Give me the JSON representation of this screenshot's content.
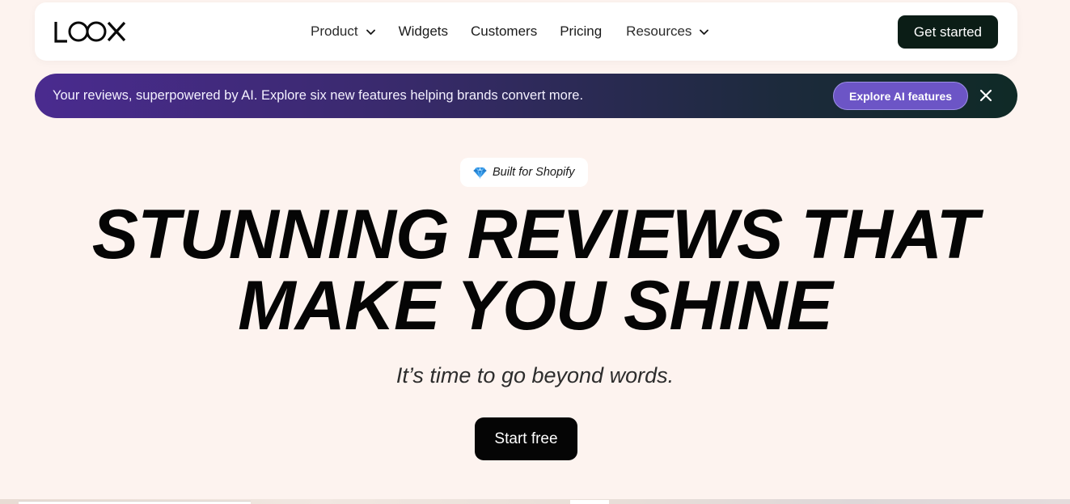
{
  "nav": {
    "logo_text": "LOOX",
    "items": [
      {
        "label": "Product",
        "dropdown": true
      },
      {
        "label": "Widgets",
        "dropdown": false
      },
      {
        "label": "Customers",
        "dropdown": false
      },
      {
        "label": "Pricing",
        "dropdown": false
      },
      {
        "label": "Resources",
        "dropdown": true
      }
    ],
    "cta_label": "Get started"
  },
  "banner": {
    "text": "Your reviews, superpowered by AI. Explore six new features helping brands convert more.",
    "button_label": "Explore AI features",
    "close_icon": "close-icon"
  },
  "hero": {
    "badge_icon": "gem-icon",
    "badge_text": "Built for Shopify",
    "headline_line1": "STUNNING REVIEWS THAT",
    "headline_line2": "MAKE YOU SHINE",
    "subheadline": "It’s time to go beyond words.",
    "cta_label": "Start free"
  },
  "colors": {
    "page_bg": "#fdf3ef",
    "nav_cta_bg": "#0b1d16",
    "banner_start": "#4a2b8f",
    "banner_end": "#0f2a26",
    "banner_button": "#6c55c6",
    "primary_cta": "#050505"
  }
}
